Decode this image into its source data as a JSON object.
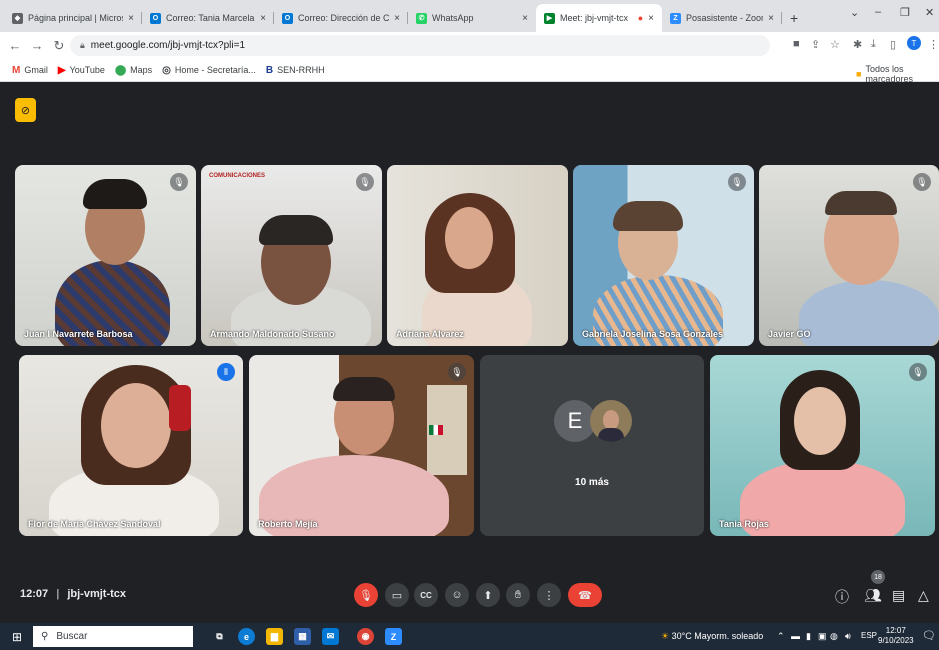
{
  "browser": {
    "tabs": [
      {
        "title": "Página principal | Microsoft",
        "close": "×",
        "color": "#5f6368",
        "glyph": "◆"
      },
      {
        "title": "Correo: Tania Marcela Rojas",
        "close": "×",
        "color": "#0078d4",
        "glyph": "O"
      },
      {
        "title": "Correo: Dirección de Coopera",
        "close": "×",
        "color": "#0078d4",
        "glyph": "O"
      },
      {
        "title": "WhatsApp",
        "close": "×",
        "color": "#25d366",
        "glyph": "✆"
      },
      {
        "title": "Meet: jbj-vmjt-tcx",
        "close": "×",
        "color": "#00832d",
        "glyph": "▶"
      },
      {
        "title": "Posasistente - Zoom",
        "close": "×",
        "color": "#2d8cff",
        "glyph": "Z"
      }
    ],
    "new_tab": "+",
    "url": "meet.google.com/jbj-vmjt-tcx?pli=1",
    "bookmarks": [
      {
        "label": "Gmail",
        "glyph": "M",
        "color": "#ea4335"
      },
      {
        "label": "YouTube",
        "glyph": "▶",
        "color": "#ff0000"
      },
      {
        "label": "Maps",
        "glyph": "⬤",
        "color": "#34a853"
      },
      {
        "label": "Home - Secretaría...",
        "glyph": "◎",
        "color": "#3c4043"
      },
      {
        "label": "SEN-RRHH",
        "glyph": "B",
        "color": "#1a3d8f"
      }
    ],
    "all_bookmarks": "Todos los marcadores"
  },
  "meet": {
    "participants": [
      {
        "name": "Juan I Navarrete Barbosa",
        "mic": "muted"
      },
      {
        "name": "Armando Maldonado Susano",
        "mic": "muted",
        "banner": "COMUNICACIONES"
      },
      {
        "name": "Adriana Alvarez",
        "mic": "none"
      },
      {
        "name": "Gabriela Joselina Sosa Gonzales",
        "mic": "muted"
      },
      {
        "name": "Javier GO",
        "mic": "muted"
      },
      {
        "name": "Flor de María Chávez Sandoval",
        "mic": "speaking"
      },
      {
        "name": "Roberto Mejía",
        "mic": "muted"
      },
      {
        "name": "Tania Rojas",
        "mic": "muted"
      }
    ],
    "more": {
      "initial": "E",
      "label": "10 más"
    },
    "clock": "12:07",
    "meeting_code": "jbj-vmjt-tcx",
    "participant_count": "18"
  },
  "taskbar": {
    "search_placeholder": "Buscar",
    "weather": "30°C  Mayorm. soleado",
    "lang": "ESP",
    "time": "12:07",
    "date": "9/10/2023"
  }
}
